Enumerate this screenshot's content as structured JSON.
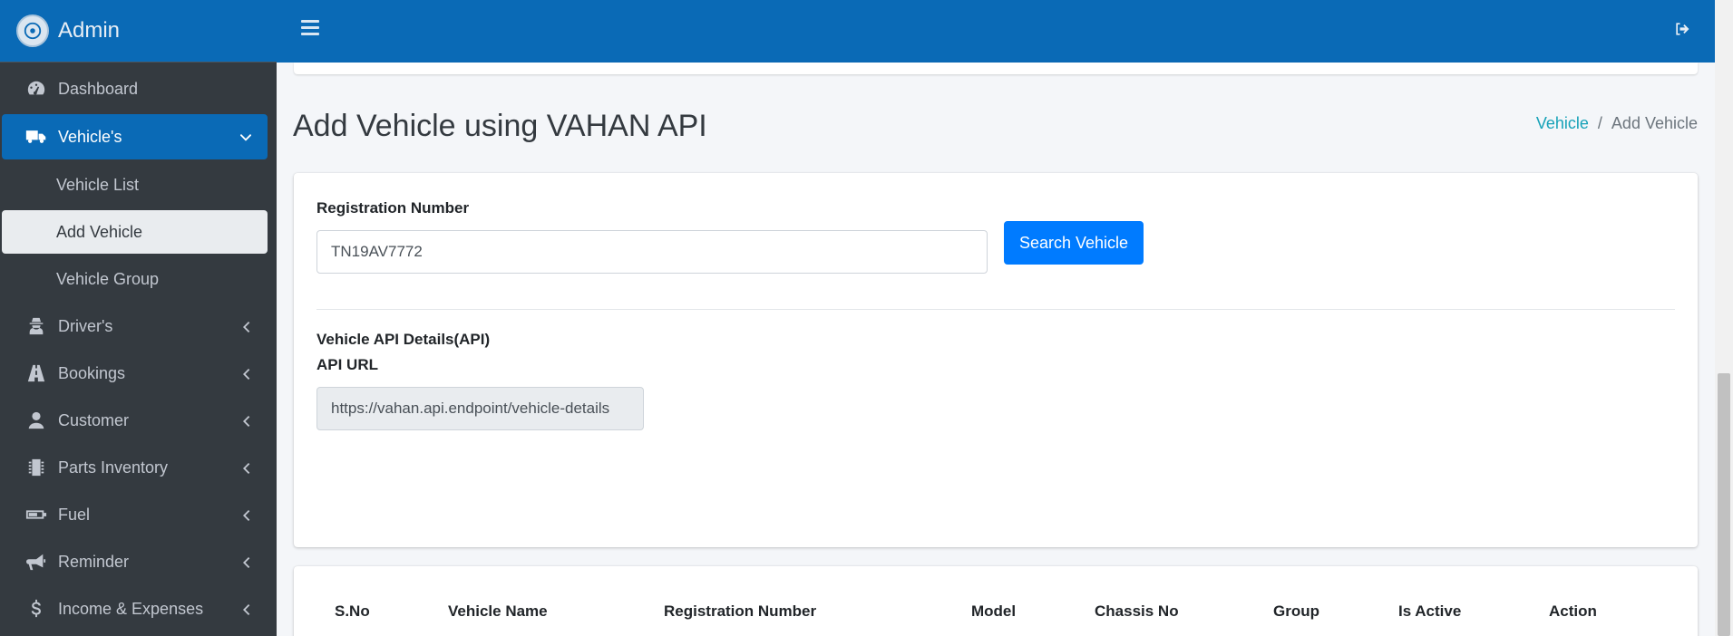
{
  "brand": {
    "name": "Admin"
  },
  "sidebar": {
    "items": [
      {
        "label": "Dashboard",
        "icon": "tachometer-icon"
      },
      {
        "label": "Vehicle's",
        "icon": "truck-icon"
      },
      {
        "label": "Vehicle List"
      },
      {
        "label": "Add Vehicle"
      },
      {
        "label": "Vehicle Group"
      },
      {
        "label": "Driver's",
        "icon": "user-secret-icon"
      },
      {
        "label": "Bookings",
        "icon": "road-icon"
      },
      {
        "label": "Customer",
        "icon": "user-icon"
      },
      {
        "label": "Parts Inventory",
        "icon": "microchip-icon"
      },
      {
        "label": "Fuel",
        "icon": "battery-icon"
      },
      {
        "label": "Reminder",
        "icon": "bullhorn-icon"
      },
      {
        "label": "Income & Expenses",
        "icon": "dollar-icon"
      }
    ]
  },
  "page": {
    "title": "Add Vehicle using VAHAN API",
    "breadcrumb": {
      "parent": "Vehicle",
      "current": "Add Vehicle"
    }
  },
  "form": {
    "registration_label": "Registration Number",
    "registration_value": "TN19AV7772",
    "search_button": "Search Vehicle",
    "api_details_label": "Vehicle API Details(API)",
    "api_url_label": "API URL",
    "api_url_value": "https://vahan.api.endpoint/vehicle-details"
  },
  "table": {
    "headers": [
      "S.No",
      "Vehicle Name",
      "Registration Number",
      "Model",
      "Chassis No",
      "Group",
      "Is Active",
      "Action"
    ]
  },
  "colors": {
    "primary": "#0a6ab6",
    "button": "#007bff",
    "sidebar_bg": "#343a40",
    "link": "#17a2b8"
  }
}
